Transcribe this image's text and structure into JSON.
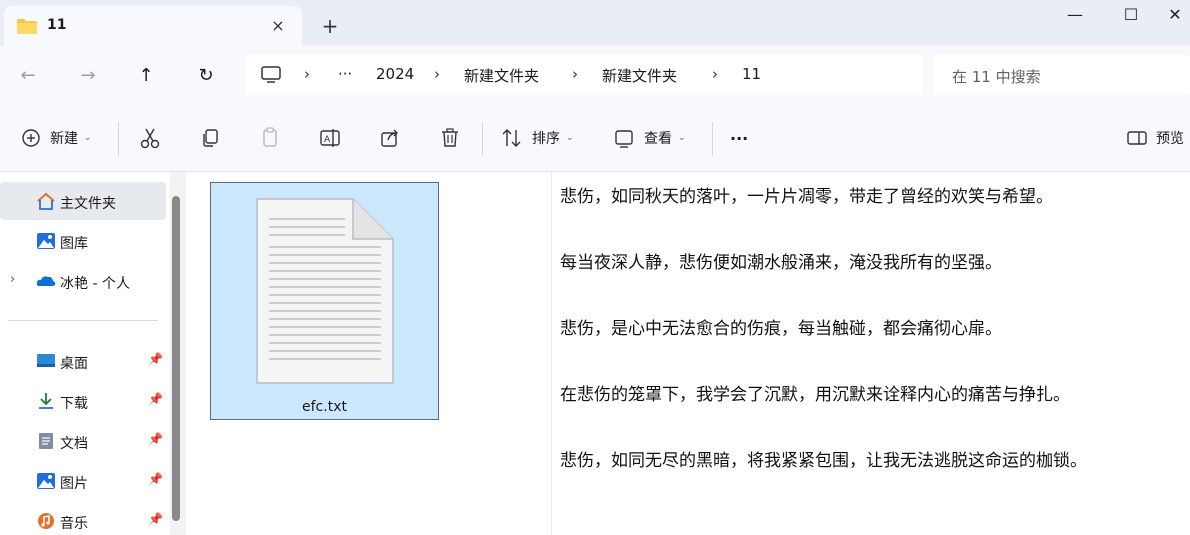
{
  "tab": {
    "title": "11",
    "close": "×",
    "new_tab": "+"
  },
  "window": {
    "minimize": "—",
    "maximize": "☐",
    "close": "✕"
  },
  "nav": {
    "back": "←",
    "forward": "→",
    "up": "↑",
    "refresh": "↻"
  },
  "breadcrumb": {
    "more": "···",
    "items": [
      "2024",
      "新建文件夹",
      "新建文件夹",
      "11"
    ],
    "separator": "›"
  },
  "search": {
    "placeholder": "在 11 中搜索"
  },
  "toolbar": {
    "new_label": "新建",
    "sort_label": "排序",
    "view_label": "查看",
    "more_label": "···",
    "preview_label": "预览"
  },
  "sidebar": {
    "items": [
      {
        "label": "主文件夹",
        "icon": "home-icon"
      },
      {
        "label": "图库",
        "icon": "gallery-icon"
      },
      {
        "label": "冰艳 - 个人",
        "icon": "onedrive-icon"
      },
      {
        "label": "桌面",
        "icon": "desktop-icon"
      },
      {
        "label": "下载",
        "icon": "download-icon"
      },
      {
        "label": "文档",
        "icon": "document-icon"
      },
      {
        "label": "图片",
        "icon": "pictures-icon"
      },
      {
        "label": "音乐",
        "icon": "music-icon"
      }
    ],
    "expander": "›"
  },
  "files": [
    {
      "name": "efc.txt",
      "selected": true
    }
  ],
  "preview": {
    "lines": [
      "悲伤，如同秋天的落叶，一片片凋零，带走了曾经的欢笑与希望。",
      "每当夜深人静，悲伤便如潮水般涌来，淹没我所有的坚强。",
      "悲伤，是心中无法愈合的伤痕，每当触碰，都会痛彻心扉。",
      "在悲伤的笼罩下，我学会了沉默，用沉默来诠释内心的痛苦与挣扎。",
      "悲伤，如同无尽的黑暗，将我紧紧包围，让我无法逃脱这命运的枷锁。"
    ]
  },
  "colors": {
    "accent": "#0067c0",
    "selection": "#cce8ff",
    "folder": "#f8c646"
  }
}
